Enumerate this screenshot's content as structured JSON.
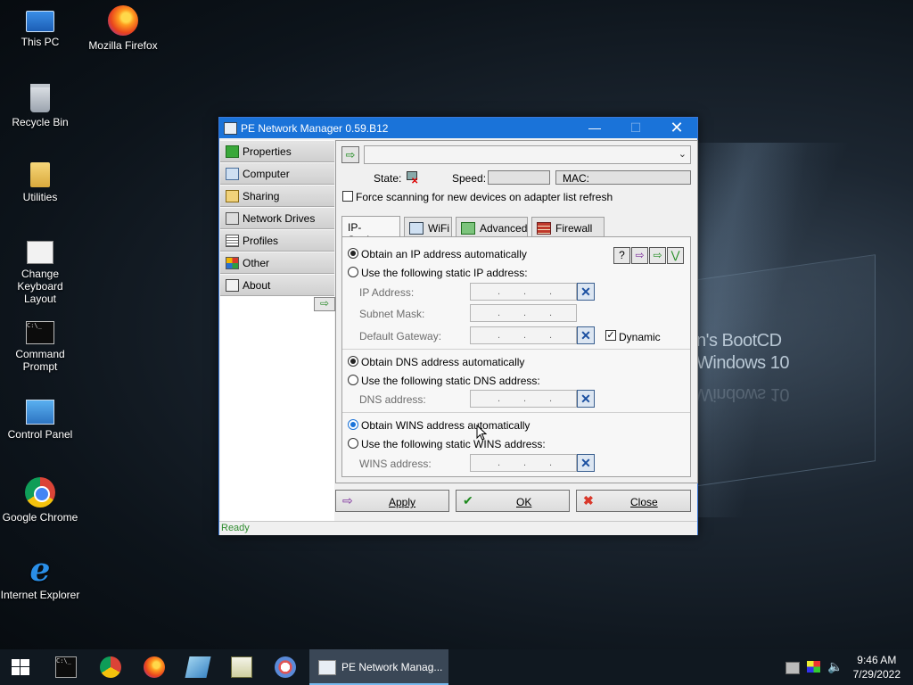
{
  "desktop": {
    "wallpaper_text_line1": "n's BootCD",
    "wallpaper_text_line2": "Windows 10",
    "icons": [
      {
        "label": "This PC",
        "icon": "computer-icon"
      },
      {
        "label": "Mozilla Firefox",
        "icon": "firefox-icon"
      },
      {
        "label": "Recycle Bin",
        "icon": "recycle-bin-icon"
      },
      {
        "label": "Utilities",
        "icon": "folder-icon"
      },
      {
        "label": "Change\nKeyboard Layout",
        "line1": "Change",
        "line2": "Keyboard Layout",
        "icon": "keyboard-icon"
      },
      {
        "label": "Command Prompt",
        "line1": "Command",
        "line2": "Prompt",
        "icon": "cmd-icon"
      },
      {
        "label": "Control Panel",
        "icon": "control-panel-icon"
      },
      {
        "label": "Google Chrome",
        "icon": "chrome-icon"
      },
      {
        "label": "Internet Explorer",
        "icon": "ie-icon"
      }
    ]
  },
  "window": {
    "title": "PE Network Manager 0.59.B12",
    "sidebar": [
      {
        "label": "Properties",
        "icon": "properties-icon",
        "color": "#3aa83a"
      },
      {
        "label": "Computer",
        "icon": "computer-icon",
        "color": "#4a6e9a"
      },
      {
        "label": "Sharing",
        "icon": "sharing-icon",
        "color": "#d4a52a"
      },
      {
        "label": "Network Drives",
        "icon": "network-drive-icon",
        "color": "#555555"
      },
      {
        "label": "Profiles",
        "icon": "profiles-icon",
        "color": "#777777"
      },
      {
        "label": "Other",
        "icon": "other-icon",
        "color": "#d9382b"
      },
      {
        "label": "About",
        "icon": "about-icon",
        "color": "#444444"
      }
    ],
    "state_label": "State:",
    "speed_label": "Speed:",
    "mac_label": "MAC:",
    "force_scan_label": "Force scanning for new devices on adapter list refresh",
    "tabs": [
      {
        "label": "IP-Settings",
        "active": true
      },
      {
        "label": "WiFi",
        "icon": "wifi-icon"
      },
      {
        "label": "Advanced",
        "icon": "advanced-icon"
      },
      {
        "label": "Firewall",
        "icon": "firewall-icon"
      }
    ],
    "ip": {
      "auto_label": "Obtain an IP address automatically",
      "static_label": "Use the following static IP address:",
      "address_label": "IP Address:",
      "mask_label": "Subnet Mask:",
      "gateway_label": "Default Gateway:",
      "dynamic_label": "Dynamic"
    },
    "dns": {
      "auto_label": "Obtain DNS address automatically",
      "static_label": "Use the following static DNS address:",
      "address_label": "DNS address:"
    },
    "wins": {
      "auto_label": "Obtain WINS address automatically",
      "static_label": "Use the following static WINS address:",
      "address_label": "WINS address:"
    },
    "ip_dot": ".",
    "buttons": {
      "apply": "Apply",
      "ok": "OK",
      "close": "Close"
    },
    "status": "Ready"
  },
  "taskbar": {
    "active_app": "PE Network Manag...",
    "time": "9:46 AM",
    "date": "7/29/2022"
  }
}
